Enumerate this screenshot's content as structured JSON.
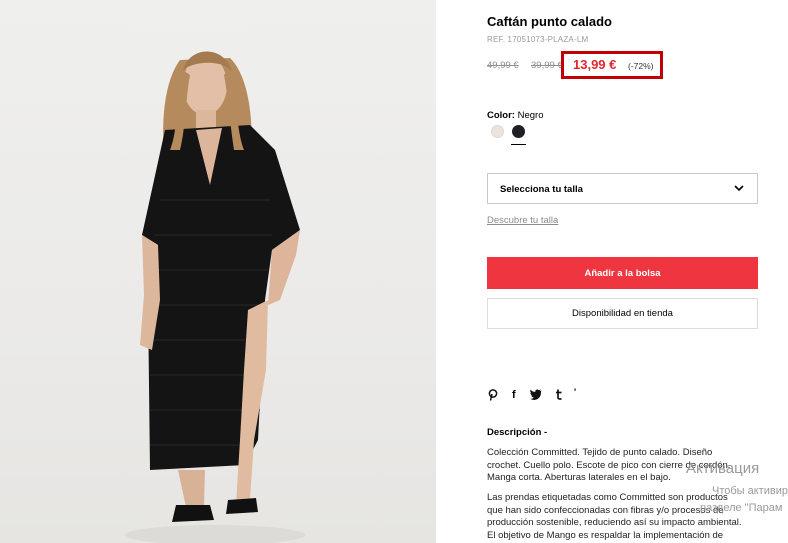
{
  "product": {
    "title": "Caftán punto calado",
    "ref": "REF. 17051073-PLAZA-LM",
    "old_price_1": "49,99 €",
    "old_price_2": "39,99 €",
    "price": "13,99 €",
    "discount": "(-72%)",
    "color_label": "Color:",
    "color_value": "Negro",
    "colors": [
      "#ebe4dd",
      "#1e2026"
    ],
    "accent_color": "#ee3540"
  },
  "size": {
    "select_label": "Selecciona tu talla",
    "guide_link": "Descubre tu talla"
  },
  "actions": {
    "add_to_bag": "Añadir a la bolsa",
    "store_availability": "Disponibilidad en tienda"
  },
  "share": {
    "icons": [
      "pinterest-icon",
      "facebook-icon",
      "twitter-icon",
      "tumblr-icon"
    ],
    "labels": [
      "P",
      "f",
      "t"
    ]
  },
  "description": {
    "title": "Descripción  -",
    "para1_lines": [
      "Colección Committed. Tejido de punto calado. Diseño",
      "crochet. Cuello polo. Escote de pico con cierre de cordón.",
      "Manga corta. Aberturas laterales en el bajo."
    ],
    "para2_lines": [
      "Las prendas etiquetadas como Committed son productos",
      "que han sido confeccionadas con fibras y/o procesos de",
      "producción sostenible, reduciendo así su impacto ambiental.",
      "El objetivo de Mango es respaldar la implementación de"
    ]
  },
  "os_watermark": {
    "line1": "Активация",
    "line2": "Чтобы активир",
    "line3": "разделе \"Парам"
  }
}
